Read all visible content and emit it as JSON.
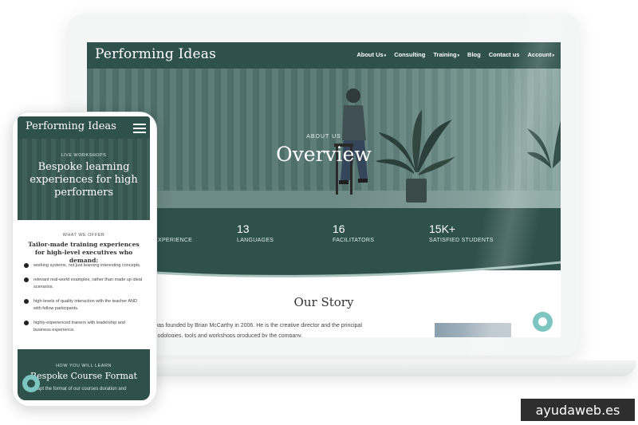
{
  "laptop": {
    "logo": "Performing Ideas",
    "nav": [
      {
        "label": "About Us",
        "has_dropdown": true
      },
      {
        "label": "Consulting",
        "has_dropdown": false
      },
      {
        "label": "Training",
        "has_dropdown": true
      },
      {
        "label": "Blog",
        "has_dropdown": false
      },
      {
        "label": "Contact us",
        "has_dropdown": false
      },
      {
        "label": "Account",
        "has_dropdown": true
      }
    ],
    "hero": {
      "eyebrow": "ABOUT US",
      "title": "Overview"
    },
    "stats": [
      {
        "number": "",
        "label": "EXPERIENCE"
      },
      {
        "number": "13",
        "label": "LANGUAGES"
      },
      {
        "number": "16",
        "label": "FACILITATORS"
      },
      {
        "number": "15K+",
        "label": "SATISFIED STUDENTS"
      }
    ],
    "story": {
      "title": "Our Story",
      "line1": "ming Ideas was founded by Brian McCarthy in 2006. He is the creative director and the principal",
      "line2": "er of all methodologies, tools and workshops produced by the company."
    }
  },
  "phone": {
    "logo": "Performing Ideas",
    "hero": {
      "eyebrow": "LIVE WORKSHOPS",
      "title": "Bespoke learning experiences for high performers"
    },
    "offer": {
      "eyebrow": "WHAT WE OFFER",
      "heading": "Tailor-made training experiences for high-level executives who demand:",
      "items": [
        "working systems, not just learning interesting concepts.",
        "relevant real-world examples, rather than made up ideal scenarios.",
        "high-levels of quality interaction with the teacher AND with fellow participants.",
        "highly-experienced trainers with leadership and business experience."
      ]
    },
    "learn": {
      "eyebrow": "HOW YOU WILL LEARN",
      "title": "Bespoke Course Format",
      "text": "adapt the format of our courses  duration and"
    }
  },
  "watermark": "ayudaweb.es",
  "colors": {
    "brand": "#2f514c",
    "accent": "#7dc5c0"
  },
  "icons": [
    "chevron-down-icon",
    "hamburger-menu-icon",
    "check-bullet-icon",
    "chat-icon"
  ]
}
